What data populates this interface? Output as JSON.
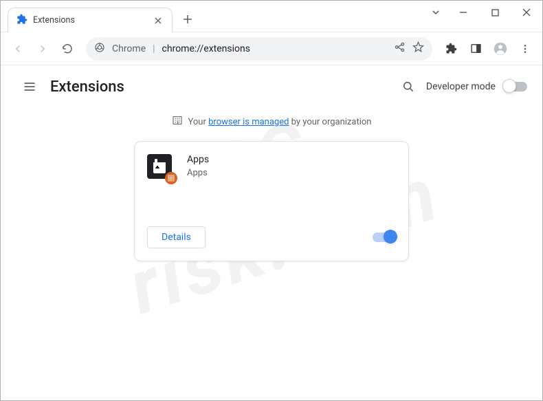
{
  "titlebar": {
    "tab_title": "Extensions"
  },
  "omnibox": {
    "host": "Chrome",
    "path": "chrome://extensions"
  },
  "ext_header": {
    "title": "Extensions",
    "dev_mode_label": "Developer mode"
  },
  "managed": {
    "prefix": "Your ",
    "link": "browser is managed",
    "suffix": " by your organization"
  },
  "card": {
    "name": "Apps",
    "description": "Apps",
    "details_label": "Details"
  }
}
